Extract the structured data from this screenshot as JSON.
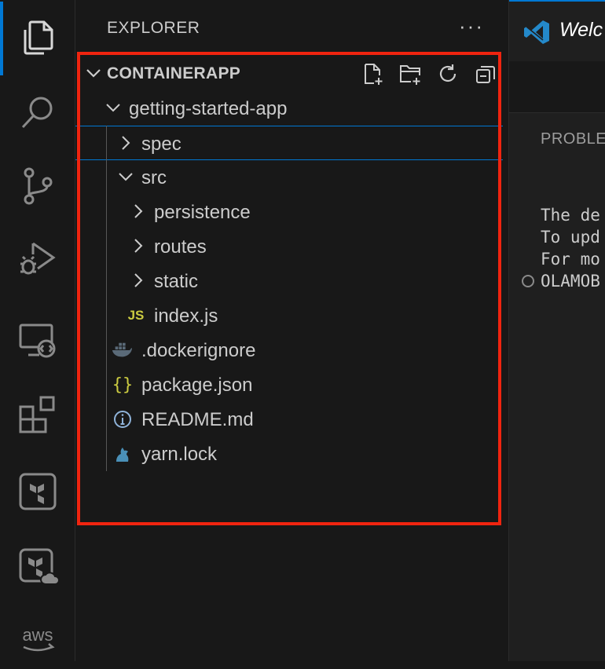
{
  "sidebar": {
    "title": "EXPLORER",
    "more_label": "···",
    "section": {
      "label": "CONTAINERAPP",
      "actions": [
        "new-file-icon",
        "new-folder-icon",
        "refresh-icon",
        "collapse-all-icon"
      ]
    },
    "tree": [
      {
        "label": "getting-started-app",
        "type": "folder",
        "expanded": true,
        "depth": 0
      },
      {
        "label": "spec",
        "type": "folder",
        "expanded": false,
        "depth": 1,
        "selected": true
      },
      {
        "label": "src",
        "type": "folder",
        "expanded": true,
        "depth": 1
      },
      {
        "label": "persistence",
        "type": "folder",
        "expanded": false,
        "depth": 2
      },
      {
        "label": "routes",
        "type": "folder",
        "expanded": false,
        "depth": 2
      },
      {
        "label": "static",
        "type": "folder",
        "expanded": false,
        "depth": 2
      },
      {
        "label": "index.js",
        "type": "file",
        "icon": "js-file-icon",
        "depth": 2
      },
      {
        "label": ".dockerignore",
        "type": "file",
        "icon": "docker-icon",
        "depth": 1
      },
      {
        "label": "package.json",
        "type": "file",
        "icon": "json-braces-icon",
        "depth": 1
      },
      {
        "label": "README.md",
        "type": "file",
        "icon": "info-icon",
        "depth": 1
      },
      {
        "label": "yarn.lock",
        "type": "file",
        "icon": "yarn-icon",
        "depth": 1
      }
    ]
  },
  "activity_bar": [
    "explorer-icon",
    "search-icon",
    "source-control-icon",
    "run-debug-icon",
    "remote-explorer-icon",
    "extensions-icon",
    "terraform-icon",
    "terraform-cloud-icon",
    "aws-icon"
  ],
  "aws_label": "aws",
  "js_badge": "JS",
  "editor": {
    "tab_label": "Welc",
    "panel_title": "PROBLE",
    "terminal_lines": [
      "The de",
      "To upd",
      "For mo",
      "OLAMOB"
    ]
  },
  "colors": {
    "accent": "#0078d4",
    "highlight": "#f0240f",
    "json": "#cbcb41",
    "js": "#cbcb41",
    "docker": "#5a6a78",
    "yarn": "#4a90b8",
    "info": "#8fb3d9"
  }
}
